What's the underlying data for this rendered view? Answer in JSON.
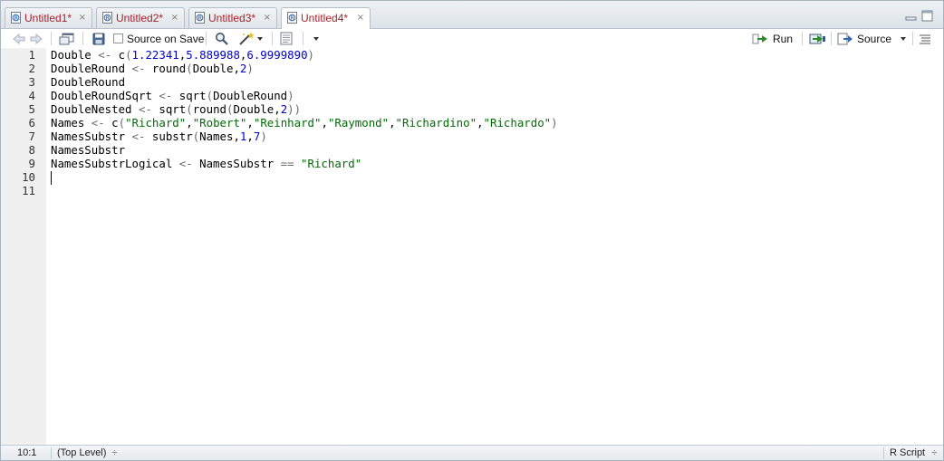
{
  "tabs": [
    {
      "label": "Untitled1*",
      "close": "×",
      "active": false
    },
    {
      "label": "Untitled2*",
      "close": "×",
      "active": false
    },
    {
      "label": "Untitled3*",
      "close": "×",
      "active": false
    },
    {
      "label": "Untitled4*",
      "close": "×",
      "active": true
    }
  ],
  "toolbar": {
    "source_on_save_label": "Source on Save",
    "run_label": "Run",
    "source_label": "Source"
  },
  "editor": {
    "lines": [
      {
        "number": "1",
        "tokens": [
          [
            "id",
            "Double"
          ],
          [
            "op",
            " <- "
          ],
          [
            "id",
            "c"
          ],
          [
            "paren",
            "("
          ],
          [
            "num",
            "1.22341"
          ],
          [
            "id",
            ","
          ],
          [
            "num",
            "5.889988"
          ],
          [
            "id",
            ","
          ],
          [
            "num",
            "6.9999890"
          ],
          [
            "paren",
            ")"
          ]
        ]
      },
      {
        "number": "2",
        "tokens": [
          [
            "id",
            "DoubleRound"
          ],
          [
            "op",
            " <- "
          ],
          [
            "id",
            "round"
          ],
          [
            "paren",
            "("
          ],
          [
            "id",
            "Double,"
          ],
          [
            "num",
            "2"
          ],
          [
            "paren",
            ")"
          ]
        ]
      },
      {
        "number": "3",
        "tokens": [
          [
            "id",
            "DoubleRound"
          ]
        ]
      },
      {
        "number": "4",
        "tokens": [
          [
            "id",
            "DoubleRoundSqrt"
          ],
          [
            "op",
            " <- "
          ],
          [
            "id",
            "sqrt"
          ],
          [
            "paren",
            "("
          ],
          [
            "id",
            "DoubleRound"
          ],
          [
            "paren",
            ")"
          ]
        ]
      },
      {
        "number": "5",
        "tokens": [
          [
            "id",
            "DoubleNested"
          ],
          [
            "op",
            " <- "
          ],
          [
            "id",
            "sqrt"
          ],
          [
            "paren",
            "("
          ],
          [
            "id",
            "round"
          ],
          [
            "paren",
            "("
          ],
          [
            "id",
            "Double,"
          ],
          [
            "num",
            "2"
          ],
          [
            "paren",
            "))"
          ]
        ]
      },
      {
        "number": "6",
        "tokens": [
          [
            "id",
            "Names"
          ],
          [
            "op",
            " <- "
          ],
          [
            "id",
            "c"
          ],
          [
            "paren",
            "("
          ],
          [
            "str",
            "\"Richard\""
          ],
          [
            "id",
            ","
          ],
          [
            "str",
            "\"Robert\""
          ],
          [
            "id",
            ","
          ],
          [
            "str",
            "\"Reinhard\""
          ],
          [
            "id",
            ","
          ],
          [
            "str",
            "\"Raymond\""
          ],
          [
            "id",
            ","
          ],
          [
            "str",
            "\"Richardino\""
          ],
          [
            "id",
            ","
          ],
          [
            "str",
            "\"Richardo\""
          ],
          [
            "paren",
            ")"
          ]
        ]
      },
      {
        "number": "7",
        "tokens": [
          [
            "id",
            "NamesSubstr"
          ],
          [
            "op",
            " <- "
          ],
          [
            "id",
            "substr"
          ],
          [
            "paren",
            "("
          ],
          [
            "id",
            "Names,"
          ],
          [
            "num",
            "1"
          ],
          [
            "id",
            ","
          ],
          [
            "num",
            "7"
          ],
          [
            "paren",
            ")"
          ]
        ]
      },
      {
        "number": "8",
        "tokens": [
          [
            "id",
            "NamesSubstr"
          ]
        ]
      },
      {
        "number": "9",
        "tokens": [
          [
            "id",
            "NamesSubstrLogical"
          ],
          [
            "op",
            " <- "
          ],
          [
            "id",
            "NamesSubstr"
          ],
          [
            "op",
            " == "
          ],
          [
            "str",
            "\"Richard\""
          ]
        ]
      },
      {
        "number": "10",
        "tokens": []
      },
      {
        "number": "11",
        "tokens": []
      }
    ]
  },
  "status": {
    "position": "10:1",
    "scope": "(Top Level)",
    "scope_arrow": "÷",
    "file_type": "R Script",
    "file_type_arrow": "÷"
  },
  "colors": {
    "tab_text": "#a8202a",
    "string": "#036a07",
    "number": "#0000cd",
    "operator": "#6b6b6b"
  },
  "icons": {
    "tab": "r-document-icon",
    "back": "back-arrow-icon",
    "forward": "forward-arrow-icon",
    "show_in_window": "show-in-new-window-icon",
    "save": "save-icon",
    "find": "find-search-icon",
    "code_tools": "magic-wand-icon",
    "compile": "compile-report-icon",
    "run": "run-arrow-icon",
    "rerun": "rerun-icon",
    "source": "source-icon",
    "outline": "outline-lines-icon",
    "minimize": "minimize-icon",
    "maximize": "maximize-icon"
  }
}
